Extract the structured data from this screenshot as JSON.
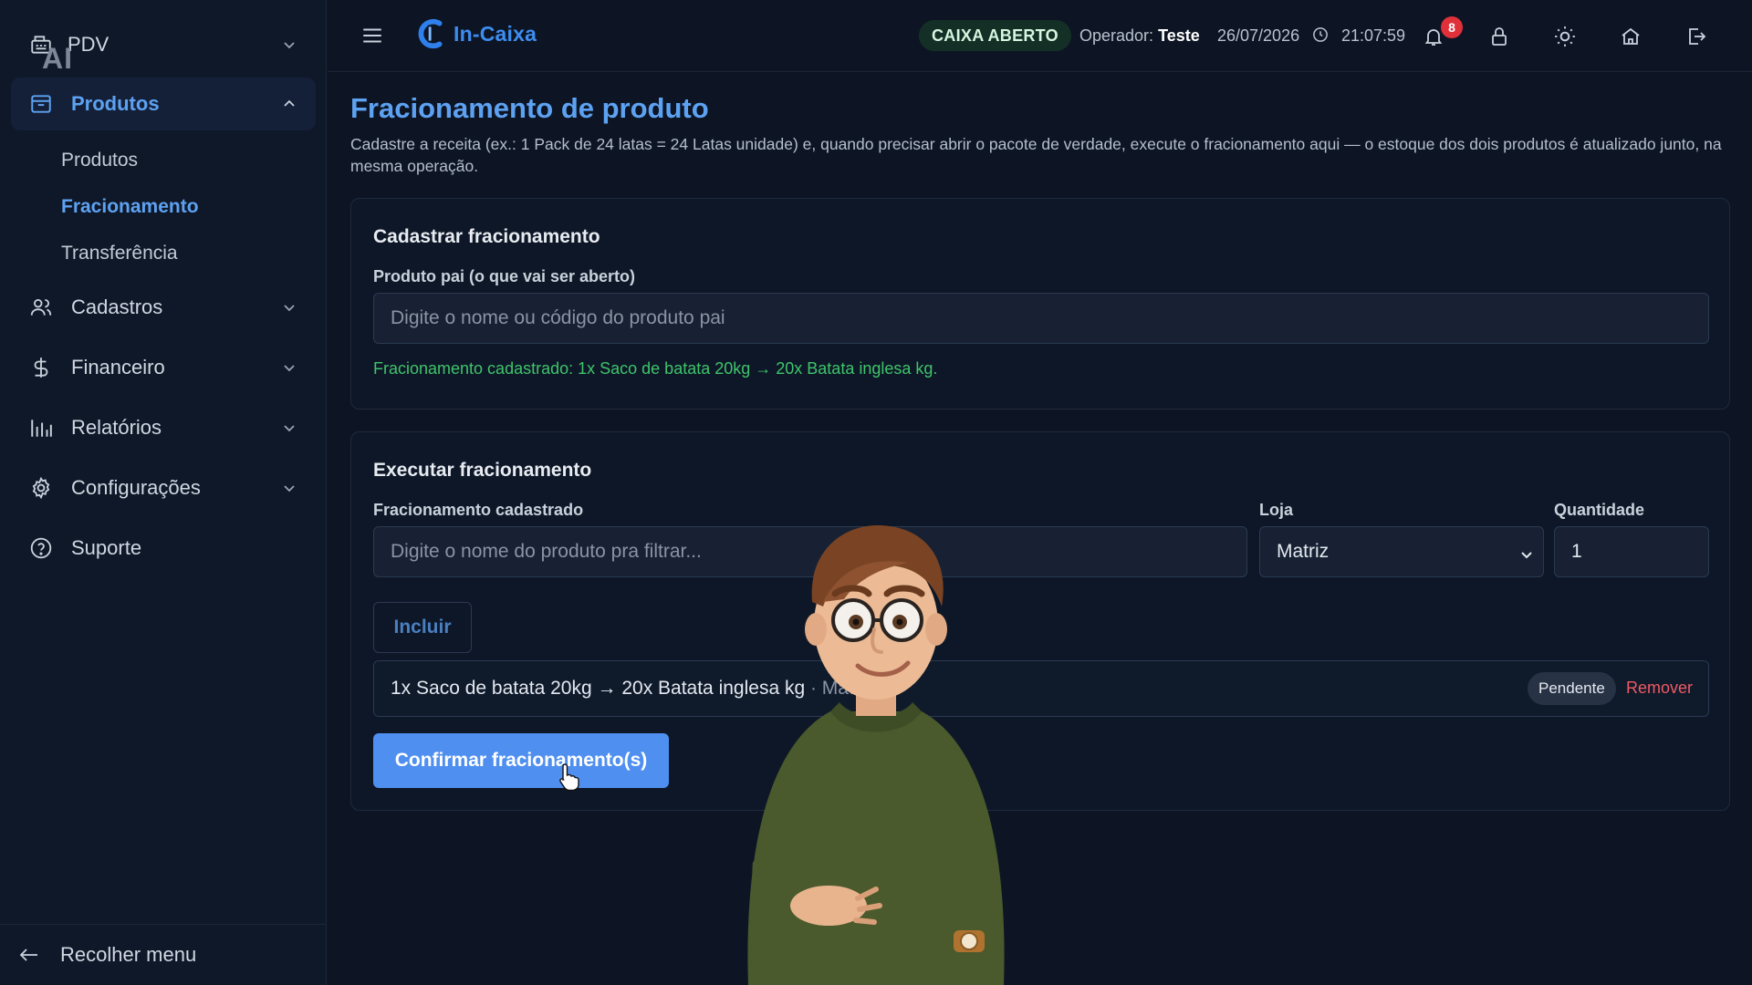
{
  "sidebar": {
    "ai_badge": "AI",
    "items": [
      {
        "label": "PDV"
      },
      {
        "label": "Produtos"
      },
      {
        "label": "Cadastros"
      },
      {
        "label": "Financeiro"
      },
      {
        "label": "Relatórios"
      },
      {
        "label": "Configurações"
      },
      {
        "label": "Suporte"
      }
    ],
    "sub_items": [
      {
        "label": "Produtos"
      },
      {
        "label": "Fracionamento"
      },
      {
        "label": "Transferência"
      }
    ],
    "collapse_label": "Recolher menu"
  },
  "header": {
    "logo_text": "In-Caixa",
    "status": "CAIXA ABERTO",
    "operator_label": "Operador:",
    "operator_name": "Teste",
    "date": "26/07/2026",
    "time": "21:07:59",
    "notification_count": "8",
    "icons": [
      "menu-icon",
      "bell-icon",
      "lock-icon",
      "sun-icon",
      "home-icon",
      "logout-icon"
    ]
  },
  "main": {
    "title": "Fracionamento de produto",
    "description": "Cadastre a receita (ex.: 1 Pack de 24 latas = 24 Latas unidade) e, quando precisar abrir o pacote de verdade, execute o fracionamento aqui — o estoque dos dois produtos é atualizado junto, na mesma operação.",
    "register_card": {
      "title": "Cadastrar fracionamento",
      "parent_label": "Produto pai (o que vai ser aberto)",
      "parent_placeholder": "Digite o nome ou código do produto pai",
      "success_message": "Fracionamento cadastrado: 1x Saco de batata 20kg → 20x Batata inglesa kg."
    },
    "execute_card": {
      "title": "Executar fracionamento",
      "registered_label": "Fracionamento cadastrado",
      "registered_placeholder": "Digite o nome do produto pra filtrar...",
      "store_label": "Loja",
      "store_value": "Matriz",
      "quantity_label": "Quantidade",
      "quantity_value": "1",
      "include_button": "Incluir",
      "pending_item": {
        "description": "1x Saco de batata 20kg → 20x Batata inglesa kg",
        "store": "· Matriz",
        "status": "Pendente",
        "remove_label": "Remover"
      },
      "confirm_button": "Confirmar fracionamento(s)"
    }
  },
  "colors": {
    "accent": "#5da2f2",
    "primary_button": "#4f8ff0",
    "success": "#3fc46a",
    "danger": "#ef5a64",
    "background": "#0d1524"
  }
}
